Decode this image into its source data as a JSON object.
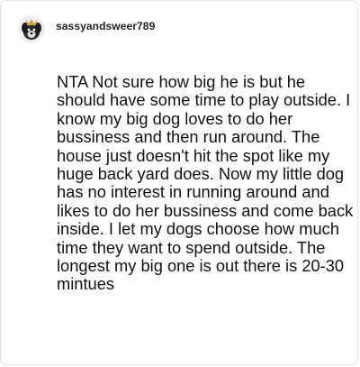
{
  "post": {
    "username": "sassyandsweer789",
    "avatar_icon": "dog-avatar-icon",
    "comment": "NTA Not sure how big he is but he should have some time to play outside. I know my big dog loves to do her bussiness and then run around. The house just doesn't hit the spot like my huge back yard does. Now my little dog has no interest in running around and likes to do her bussiness and come back inside. I let my dogs choose how much time they want to spend outside. The longest my big one is out there is 20-30 mintues"
  }
}
